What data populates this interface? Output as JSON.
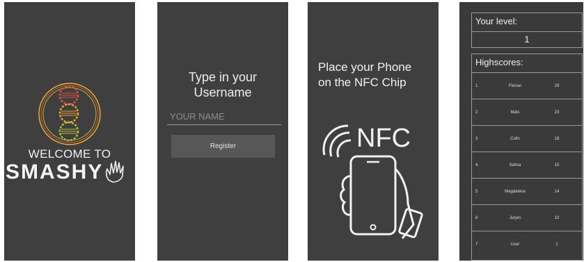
{
  "screens": {
    "welcome": {
      "welcome_text": "WELCOME TO",
      "app_name": "SMASHY"
    },
    "register": {
      "prompt": "Type in your\nUsername",
      "name_placeholder": "YOUR NAME",
      "register_label": "Register"
    },
    "nfc": {
      "instruction": "Place your Phone\non the NFC Chip",
      "nfc_text": "NFC"
    },
    "scores": {
      "level_title": "Your level:",
      "level_value": "1",
      "highscores_title": "Highscores:",
      "rows": [
        {
          "rank": "1",
          "name": "Florian",
          "score": "29"
        },
        {
          "rank": "2",
          "name": "Mats",
          "score": "23"
        },
        {
          "rank": "3",
          "name": "Colin",
          "score": "18"
        },
        {
          "rank": "4",
          "name": "Selma",
          "score": "15"
        },
        {
          "rank": "5",
          "name": "Magdalena",
          "score": "14"
        },
        {
          "rank": "6",
          "name": "Jurjen",
          "score": "10"
        },
        {
          "rank": "7",
          "name": "User",
          "score": "1"
        }
      ]
    }
  },
  "colors": {
    "screen_bg": "#3f3f3f",
    "logo_red": "#e0503a",
    "logo_orange": "#f0a22a",
    "logo_green": "#b7c234"
  }
}
